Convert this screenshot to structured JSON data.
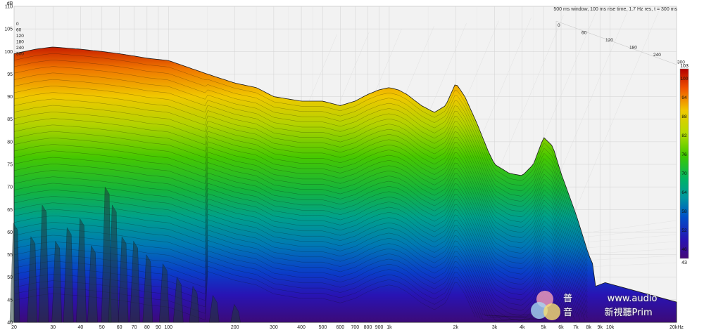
{
  "info": "500 ms window, 100 ms rise time, 1.7 Hz res, t = 300 ms",
  "unit_db": "dB",
  "unit_hz": "20kHz",
  "chart_data": {
    "type": "area",
    "subtype": "cumulative spectral decay waterfall",
    "xlabel": "",
    "ylabel": "dB",
    "x_scale": "log",
    "xlim": [
      20,
      20000
    ],
    "ylim": [
      40,
      110
    ],
    "x_ticks": [
      20,
      30,
      40,
      50,
      60,
      70,
      80,
      90,
      100,
      200,
      300,
      400,
      500,
      600,
      700,
      800,
      900,
      1000,
      2000,
      3000,
      4000,
      5000,
      6000,
      7000,
      8000,
      9000,
      10000,
      20000
    ],
    "x_tick_labels": [
      "20",
      "30",
      "40",
      "50",
      "60",
      "70",
      "80",
      "90",
      "100",
      "200",
      "300",
      "400",
      "500",
      "600",
      "700",
      "800",
      "900",
      "1k",
      "2k",
      "3k",
      "4k",
      "5k",
      "6k",
      "7k",
      "8k",
      "9k",
      "10k",
      "20kHz"
    ],
    "y_ticks": [
      40,
      45,
      50,
      55,
      60,
      65,
      70,
      75,
      80,
      85,
      90,
      95,
      100,
      105,
      110
    ],
    "time_axis_ms_labels": [
      "0",
      "60",
      "120",
      "180",
      "240",
      "300"
    ],
    "time_ms": [
      0,
      60,
      120,
      180,
      240,
      300
    ],
    "colorbar": {
      "ticks": [
        100,
        94,
        88,
        82,
        76,
        70,
        64,
        58,
        52,
        46
      ],
      "top_label": "103",
      "bottom_label": "43",
      "range": [
        43,
        103
      ]
    },
    "front_slice": {
      "name": "t = 0 ms",
      "x": [
        20,
        25,
        30,
        40,
        50,
        60,
        70,
        80,
        100,
        150,
        200,
        250,
        300,
        400,
        500,
        600,
        700,
        800,
        900,
        1000,
        1100,
        1200,
        1400,
        1600,
        1800,
        2000,
        2200,
        2500,
        2800,
        3000,
        3500,
        4000,
        4500,
        5000,
        5500,
        6000,
        7000,
        8000,
        10000,
        20000
      ],
      "y": [
        99.5,
        100.5,
        101,
        100.5,
        100,
        99.5,
        99,
        98.5,
        98,
        95,
        93,
        92,
        90,
        89,
        89,
        88,
        89,
        90.5,
        91.5,
        92,
        91.5,
        90.5,
        88,
        86.5,
        88,
        93,
        90,
        84,
        78,
        75,
        73,
        72.5,
        75,
        81,
        79,
        73,
        64,
        55,
        44,
        42
      ]
    }
  }
}
